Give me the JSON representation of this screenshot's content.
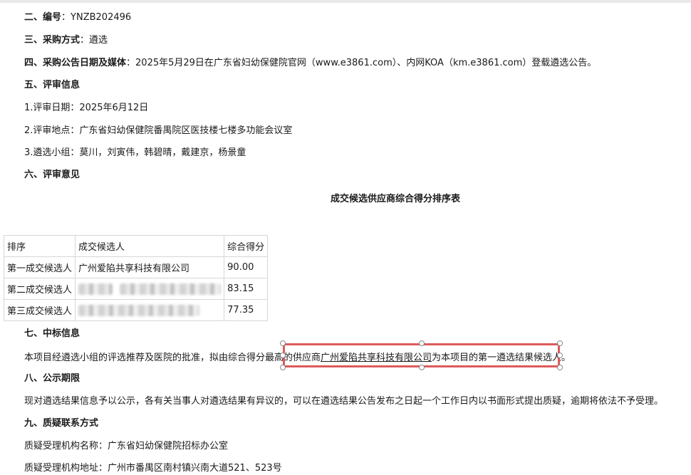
{
  "sections": {
    "bianhao": {
      "heading": "二、编号",
      "colon": "：",
      "value": "YNZB202496"
    },
    "fangshi": {
      "heading": "三、采购方式",
      "colon": "：",
      "value": "遴选"
    },
    "gonggao": {
      "heading": "四、采购公告日期及媒体",
      "colon": "：",
      "value": "2025年5月29日在广东省妇幼保健院官网（www.e3861.com）、内网KOA（km.e3861.com）登载遴选公告。"
    },
    "pingshen": {
      "heading": "五、评审信息",
      "items": [
        "1.评审日期：2025年6月12日",
        "2.评审地点：广东省妇幼保健院番禺院区医技楼七楼多功能会议室",
        "3.遴选小组：莫川，刘寅伟，韩碧晴，戴建京，杨景童"
      ]
    },
    "yijian": {
      "heading": "六、评审意见"
    },
    "zhongbiao": {
      "heading": "七、中标信息",
      "text_before": "本项目经遴选小组的评选推荐及医院的批准，拟由综合得分最高的供应商",
      "supplier_link": "广州爱陷共享科技有限公司",
      "text_after": "为本项目的第一遴选结果候选人。"
    },
    "gongshi": {
      "heading": "八、公示期限",
      "text": "现对遴选结果信息予以公示，各有关当事人对遴选结果有异议的，可以在遴选结果公告发布之日起一个工作日内以书面形式提出质疑，逾期将依法不予受理。"
    },
    "zhiyi": {
      "heading": "九、质疑联系方式",
      "items": [
        "质疑受理机构名称：广东省妇幼保健院招标办公室",
        "质疑受理机构地址：广州市番禺区南村镇兴南大道521、523号"
      ]
    }
  },
  "score_table": {
    "title": "成交候选供应商综合得分排序表",
    "headers": [
      "排序",
      "成交候选人",
      "综合得分"
    ],
    "rows": [
      {
        "rank": "第一成交候选人",
        "name": "广州爱陷共享科技有限公司",
        "score": "90.00"
      },
      {
        "rank": "第二成交候选人",
        "name": "",
        "score": "83.15"
      },
      {
        "rank": "第三成交候选人",
        "name": "",
        "score": "77.35"
      }
    ]
  },
  "colors": {
    "selection_border": "#de5a5a",
    "table_border": "#d6d6d6"
  }
}
